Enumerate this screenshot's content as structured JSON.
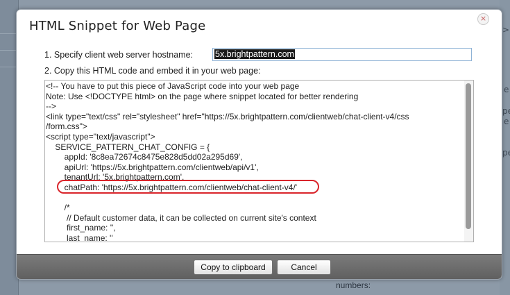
{
  "dialog": {
    "title": "HTML Snippet for Web Page",
    "close_glyph": "×",
    "step1_label": "1. Specify client web server hostname:",
    "hostname_value": "5x.brightpattern.com",
    "step2_label": "2. Copy this HTML code and embed it in your web page:",
    "code_lines": [
      "<!-- You have to put this piece of JavaScript code into your web page",
      "Note: Use <!DOCTYPE html> on the page where snippet located for better rendering",
      "-->",
      "<link type=\"text/css\" rel=\"stylesheet\" href=\"https://5x.brightpattern.com/clientweb/chat-client-v4/css",
      "/form.css\">",
      "<script type=\"text/javascript\">",
      "    SERVICE_PATTERN_CHAT_CONFIG = {",
      "        appId: '8c8ea72674c8475e828d5dd02a295d69',",
      "        apiUrl: 'https://5x.brightpattern.com/clientweb/api/v1',",
      "        tenantUrl: '5x.brightpattern.com',",
      "        chatPath: 'https://5x.brightpattern.com/clientweb/chat-client-v4/'",
      "",
      "        /*",
      "         // Default customer data, it can be collected on current site's context",
      "         first_name: '',",
      "         last_name: ''"
    ],
    "buttons": {
      "copy_label": "Copy to clipboard",
      "cancel_label": "Cancel"
    }
  },
  "background": {
    "numbers_label": "numbers:",
    "fragments": [
      ">>",
      "e",
      "pe",
      "e",
      "pe"
    ]
  },
  "colors": {
    "highlight": "#d9252b",
    "footer": "#666666",
    "input_border": "#8fb3d6"
  }
}
